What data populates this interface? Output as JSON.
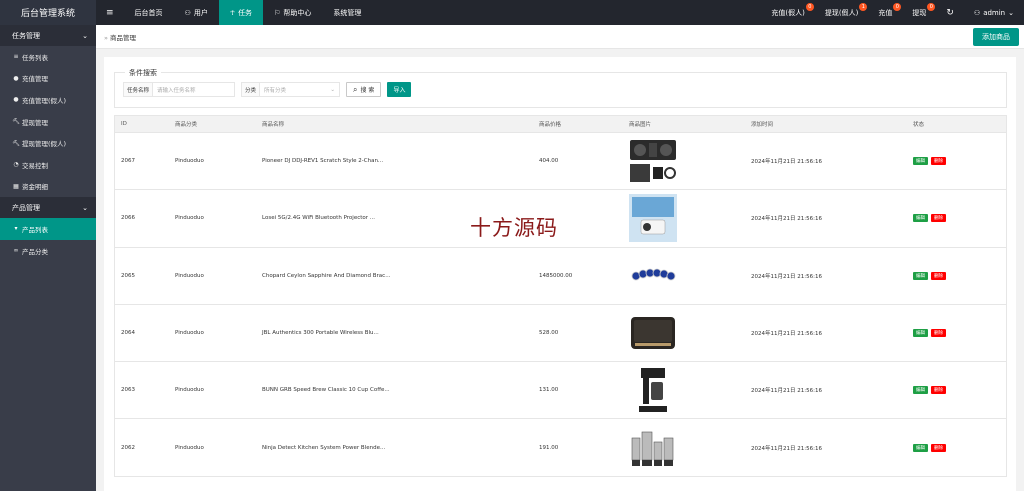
{
  "app": {
    "title": "后台管理系统"
  },
  "topnav": {
    "menu_icon": "hamburger-icon",
    "items": [
      {
        "label": "后台首页",
        "icon": ""
      },
      {
        "label": "用户",
        "icon": "user-icon"
      },
      {
        "label": "任务",
        "icon": "person-icon"
      },
      {
        "label": "帮助中心",
        "icon": "flag-icon"
      },
      {
        "label": "系统管理",
        "icon": ""
      }
    ],
    "right": [
      {
        "label": "充值(假人)",
        "badge": "0"
      },
      {
        "label": "提现(假人)",
        "badge": "1"
      },
      {
        "label": "充值",
        "badge": "0"
      },
      {
        "label": "提现",
        "badge": "0"
      }
    ],
    "user": "admin"
  },
  "sidebar": {
    "group1": "任务管理",
    "items1": [
      {
        "label": "任务列表",
        "icon": "list-icon"
      },
      {
        "label": "充值管理",
        "icon": "chat-icon"
      },
      {
        "label": "充值管理(假人)",
        "icon": "chat-icon"
      },
      {
        "label": "提现管理",
        "icon": "hammer-icon"
      },
      {
        "label": "提现管理(假人)",
        "icon": "hammer-icon"
      },
      {
        "label": "交易控制",
        "icon": "gauge-icon"
      },
      {
        "label": "资金明细",
        "icon": "calculator-icon"
      }
    ],
    "group2": "产品管理",
    "items2": [
      {
        "label": "产品列表",
        "icon": "cart-icon"
      },
      {
        "label": "产品分类",
        "icon": "link-icon"
      }
    ]
  },
  "breadcrumb": {
    "current": "商品管理"
  },
  "add_button": "添加商品",
  "search": {
    "legend": "条件搜索",
    "name_label": "任务名称",
    "name_placeholder": "请输入任务名称",
    "cat_label": "分类",
    "cat_placeholder": "所有分类",
    "search_btn": "搜 索",
    "import_btn": "导入"
  },
  "table": {
    "headers": [
      "ID",
      "商品分类",
      "商品名称",
      "商品价格",
      "商品图片",
      "添加时间",
      "状态"
    ],
    "edit_label": "编辑",
    "delete_label": "删除",
    "rows": [
      {
        "id": "2067",
        "cat": "Pinduoduo",
        "name": "Pioneer DJ DDJ-REV1 Scratch Style 2-Chan...",
        "price": "404.00",
        "time": "2024年11月21日 21:56:16"
      },
      {
        "id": "2066",
        "cat": "Pinduoduo",
        "name": "Losei 5G/2.4G WiFi Bluetooth Projector ...",
        "price": "",
        "time": "2024年11月21日 21:56:16"
      },
      {
        "id": "2065",
        "cat": "Pinduoduo",
        "name": "Chopard Ceylon Sapphire And Diamond Brac...",
        "price": "1485000.00",
        "time": "2024年11月21日 21:56:16"
      },
      {
        "id": "2064",
        "cat": "Pinduoduo",
        "name": "JBL Authentics 300 Portable Wireless Blu...",
        "price": "528.00",
        "time": "2024年11月21日 21:56:16"
      },
      {
        "id": "2063",
        "cat": "Pinduoduo",
        "name": "BUNN GRB Speed Brew Classic 10 Cup Coffe...",
        "price": "131.00",
        "time": "2024年11月21日 21:56:16"
      },
      {
        "id": "2062",
        "cat": "Pinduoduo",
        "name": "Ninja Detect Kitchen System Power Blende...",
        "price": "191.00",
        "time": "2024年11月21日 21:56:16"
      }
    ]
  },
  "watermark": "十方源码",
  "colors": {
    "accent": "#009688",
    "sidebar": "#393d49",
    "topbar": "#23262e",
    "edit": "#1e9f45",
    "delete": "#ff0000"
  }
}
